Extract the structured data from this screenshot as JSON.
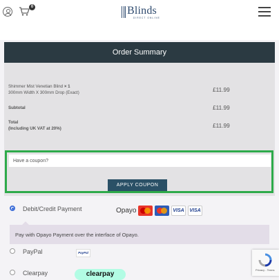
{
  "header": {
    "logo_text": "Blinds",
    "logo_subtitle": "DIRECT ONLINE",
    "cart_count": "0"
  },
  "summary": {
    "title": "Order Summary",
    "item_name": "Shimmer Mist Venetian Blind",
    "item_qty": "× 1",
    "item_dims": "300mm Width X 300mm Drop (Exact)",
    "item_price": "£11.99",
    "subtotal_label": "Subtotal",
    "subtotal_value": "£11.99",
    "total_label": "Total",
    "total_note": "(Including UK VAT at 20%)",
    "total_value": "£11.99"
  },
  "coupon": {
    "placeholder": "Have a coupon?",
    "button_label": "APPLY COUPON"
  },
  "payment": {
    "methods": [
      {
        "label": "Debit/Credit Payment",
        "checked": true
      },
      {
        "label": "PayPal",
        "checked": false
      },
      {
        "label": "Clearpay",
        "checked": false
      }
    ],
    "opayo_logo": "Opayo",
    "card_visa": "VISA",
    "card_visa_debit": "VISA",
    "description": "Pay with Opayo Payment over the interface of Opayo.",
    "paypal_badge": "PayPal",
    "clearpay_badge": "clearpay"
  },
  "recaptcha": {
    "links": "Privacy - Terms"
  },
  "colors": {
    "summary_header": "#2b3a42",
    "coupon_border": "#2daa4a",
    "coupon_button": "#2a5066",
    "radio_checked": "#3f6fd8",
    "logo_blue": "#2e4a6e",
    "clearpay_mint": "#b2fce4"
  }
}
